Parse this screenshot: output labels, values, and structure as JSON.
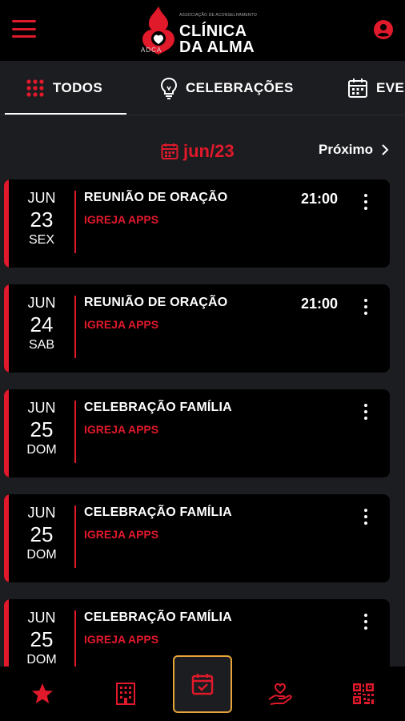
{
  "header": {
    "logo_small": "ASSOCIAÇÃO DE ACONSELHAMENTO",
    "logo_title_line1": "CLÍNICA",
    "logo_title_line2": "DA ALMA",
    "logo_abbr": "ADCA"
  },
  "tabs": [
    {
      "label": "TODOS",
      "icon": "grid-icon",
      "active": true
    },
    {
      "label": "CELEBRAÇÕES",
      "icon": "lightbulb-icon",
      "active": false
    },
    {
      "label": "EVE",
      "icon": "calendar-icon",
      "active": false
    }
  ],
  "month_nav": {
    "current": "jun/23",
    "next_label": "Próximo"
  },
  "events": [
    {
      "month": "JUN",
      "day": "23",
      "weekday": "SEX",
      "title": "REUNIÃO DE ORAÇÃO",
      "subtitle": "IGREJA APPS",
      "time": "21:00"
    },
    {
      "month": "JUN",
      "day": "24",
      "weekday": "SAB",
      "title": "REUNIÃO DE ORAÇÃO",
      "subtitle": "IGREJA APPS",
      "time": "21:00"
    },
    {
      "month": "JUN",
      "day": "25",
      "weekday": "DOM",
      "title": "CELEBRAÇÃO FAMÍLIA",
      "subtitle": "IGREJA APPS",
      "time": ""
    },
    {
      "month": "JUN",
      "day": "25",
      "weekday": "DOM",
      "title": "CELEBRAÇÃO FAMÍLIA",
      "subtitle": "IGREJA APPS",
      "time": ""
    },
    {
      "month": "JUN",
      "day": "25",
      "weekday": "DOM",
      "title": "CELEBRAÇÃO FAMÍLIA",
      "subtitle": "IGREJA APPS",
      "time": ""
    }
  ],
  "bottom_nav": [
    {
      "icon": "star-icon"
    },
    {
      "icon": "building-icon"
    },
    {
      "icon": "calendar-check-icon",
      "active": true
    },
    {
      "icon": "hand-heart-icon"
    },
    {
      "icon": "qr-code-icon"
    }
  ],
  "colors": {
    "accent": "#e0192b",
    "highlight": "#e8a33a",
    "background": "#1c1d20",
    "card": "#000000"
  }
}
